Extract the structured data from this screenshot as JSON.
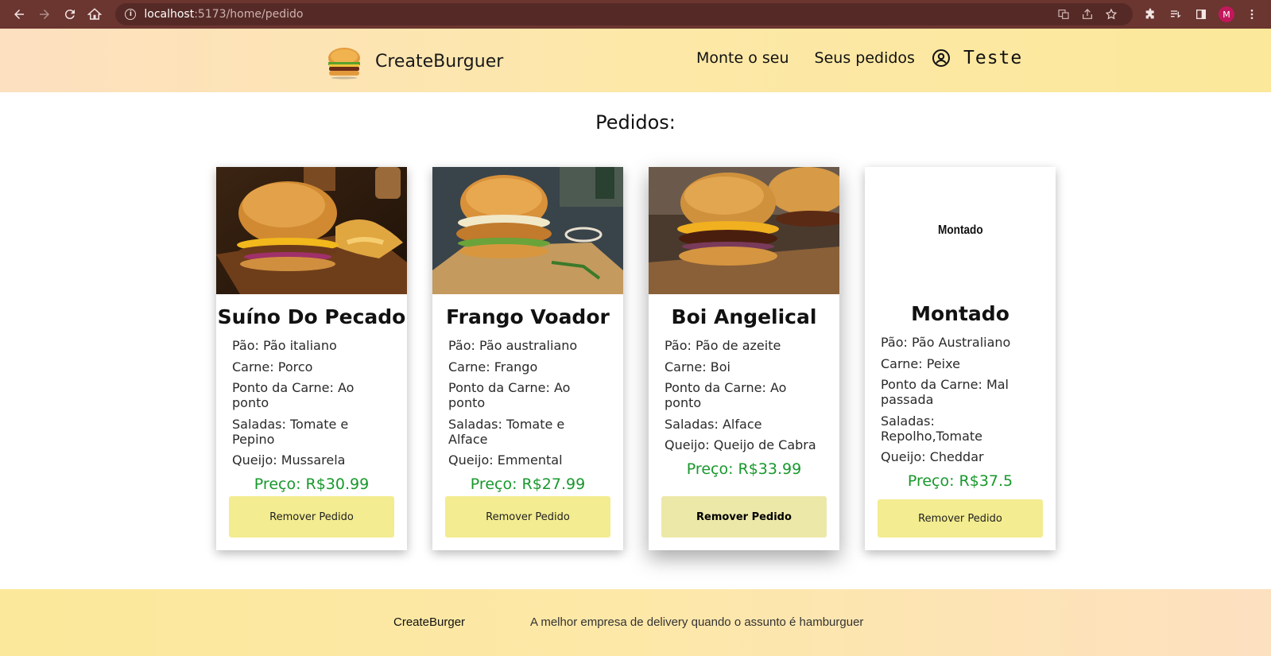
{
  "browser": {
    "url_host": "localhost",
    "url_path": ":5173/home/pedido",
    "profile_initial": "M"
  },
  "header": {
    "brand": "CreateBurguer",
    "nav": [
      "Monte o seu",
      "Seus pedidos"
    ],
    "user_name": "Teste"
  },
  "main": {
    "title": "Pedidos:",
    "orders": [
      {
        "name": "Suíno Do Pecado",
        "image": "burger-photo-pork",
        "specs": [
          "Pão: Pão italiano",
          "Carne: Porco",
          "Ponto da Carne: Ao ponto",
          "Saladas: Tomate e Pepino",
          "Queijo: Mussarela"
        ],
        "price": "Preço: R$30.99",
        "button": "Remover Pedido"
      },
      {
        "name": "Frango Voador",
        "image": "burger-photo-chicken",
        "specs": [
          "Pão: Pão australiano",
          "Carne: Frango",
          "Ponto da Carne: Ao ponto",
          "Saladas: Tomate e Alface",
          "Queijo: Emmental"
        ],
        "price": "Preço: R$27.99",
        "button": "Remover Pedido"
      },
      {
        "name": "Boi Angelical",
        "image": "burger-photo-beef",
        "specs": [
          "Pão: Pão de azeite",
          "Carne: Boi",
          "Ponto da Carne: Ao ponto",
          "Saladas: Alface",
          "Queijo: Queijo de Cabra"
        ],
        "price": "Preço: R$33.99",
        "button": "Remover Pedido"
      },
      {
        "name": "Montado",
        "image_text": "Montado",
        "specs": [
          "Pão: Pão Australiano",
          "Carne: Peixe",
          "Ponto da Carne: Mal passada",
          "Saladas: Repolho,Tomate",
          "Queijo: Cheddar"
        ],
        "price": "Preço: R$37.5",
        "button": "Remover Pedido"
      }
    ]
  },
  "footer": {
    "brand": "CreateBurger",
    "tagline": "A melhor empresa de delivery quando o assunto é hamburguer"
  },
  "colors": {
    "price": "#18982c",
    "button": "#f3ec90",
    "chrome": "#6b3530"
  }
}
